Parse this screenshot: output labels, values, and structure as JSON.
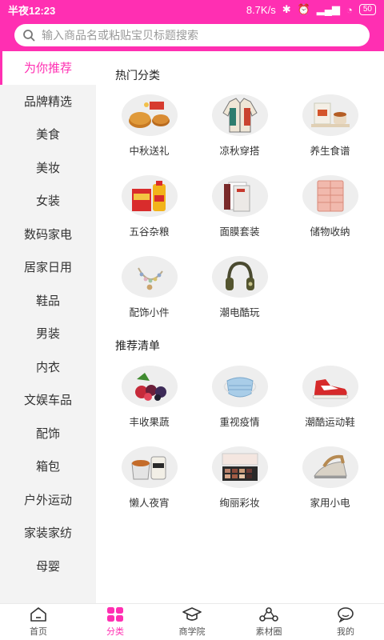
{
  "status": {
    "time": "半夜12:23",
    "speed": "8.7K/s",
    "battery": "50"
  },
  "search": {
    "placeholder": "输入商品名或粘贴宝贝标题搜索"
  },
  "sidebar": {
    "items": [
      {
        "label": "为你推荐"
      },
      {
        "label": "品牌精选"
      },
      {
        "label": "美食"
      },
      {
        "label": "美妆"
      },
      {
        "label": "女装"
      },
      {
        "label": "数码家电"
      },
      {
        "label": "居家日用"
      },
      {
        "label": "鞋品"
      },
      {
        "label": "男装"
      },
      {
        "label": "内衣"
      },
      {
        "label": "文娱车品"
      },
      {
        "label": "配饰"
      },
      {
        "label": "箱包"
      },
      {
        "label": "户外运动"
      },
      {
        "label": "家装家纺"
      },
      {
        "label": "母婴"
      }
    ]
  },
  "sections": {
    "hot": {
      "title": "热门分类",
      "items": [
        {
          "label": "中秋送礼",
          "icon": "mooncake-icon"
        },
        {
          "label": "凉秋穿搭",
          "icon": "jacket-icon"
        },
        {
          "label": "养生食谱",
          "icon": "tea-set-icon"
        },
        {
          "label": "五谷杂粮",
          "icon": "rice-oil-icon"
        },
        {
          "label": "面膜套装",
          "icon": "face-mask-box-icon"
        },
        {
          "label": "储物收纳",
          "icon": "storage-drawers-icon"
        },
        {
          "label": "配饰小件",
          "icon": "bracelet-icon"
        },
        {
          "label": "潮电酷玩",
          "icon": "headphones-icon"
        }
      ]
    },
    "rec": {
      "title": "推荐清单",
      "items": [
        {
          "label": "丰收果蔬",
          "icon": "fruits-icon"
        },
        {
          "label": "重视疫情",
          "icon": "surgical-mask-icon"
        },
        {
          "label": "潮酷运动鞋",
          "icon": "sneaker-icon"
        },
        {
          "label": "懒人夜宵",
          "icon": "snack-bowl-icon"
        },
        {
          "label": "绚丽彩妆",
          "icon": "eyeshadow-palette-icon"
        },
        {
          "label": "家用小电",
          "icon": "steam-iron-icon"
        }
      ]
    }
  },
  "tabs": [
    {
      "label": "首页",
      "icon": "home-icon"
    },
    {
      "label": "分类",
      "icon": "category-grid-icon"
    },
    {
      "label": "商学院",
      "icon": "graduation-cap-icon"
    },
    {
      "label": "素材圈",
      "icon": "material-circle-icon"
    },
    {
      "label": "我的",
      "icon": "profile-chat-icon"
    }
  ],
  "colors": {
    "brand": "#ff2fb2",
    "sidebar_bg": "#f3f3f3"
  }
}
